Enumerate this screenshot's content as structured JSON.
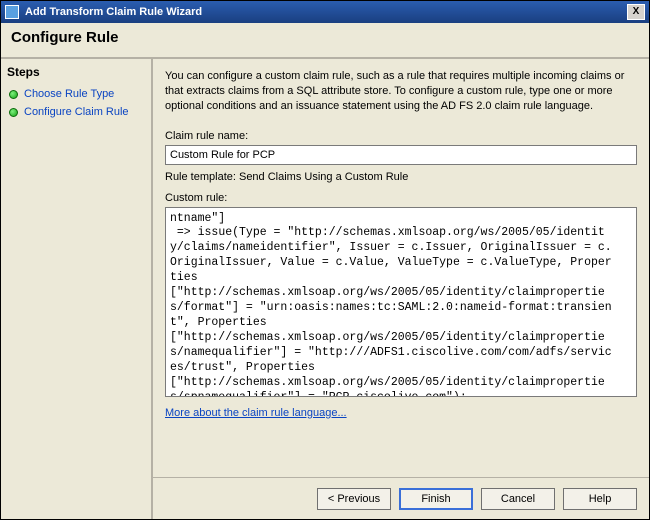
{
  "window": {
    "title": "Add Transform Claim Rule Wizard",
    "close_glyph": "X"
  },
  "header": {
    "title": "Configure Rule"
  },
  "sidebar": {
    "heading": "Steps",
    "items": [
      {
        "label": "Choose Rule Type"
      },
      {
        "label": "Configure Claim Rule"
      }
    ]
  },
  "content": {
    "intro": "You can configure a custom claim rule, such as a rule that requires multiple incoming claims or that extracts claims from a SQL attribute store. To configure a custom rule, type one or more optional conditions and an issuance statement using the AD FS 2.0 claim rule language.",
    "name_label": "Claim rule name:",
    "name_value": "Custom Rule for PCP",
    "template_line": "Rule template: Send Claims Using a Custom Rule",
    "custom_label": "Custom rule:",
    "custom_value": "ntname\"]\n => issue(Type = \"http://schemas.xmlsoap.org/ws/2005/05/identity/claims/nameidentifier\", Issuer = c.Issuer, OriginalIssuer = c.OriginalIssuer, Value = c.Value, ValueType = c.ValueType, Properties\n[\"http://schemas.xmlsoap.org/ws/2005/05/identity/claimproperties/format\"] = \"urn:oasis:names:tc:SAML:2.0:nameid-format:transient\", Properties\n[\"http://schemas.xmlsoap.org/ws/2005/05/identity/claimproperties/namequalifier\"] = \"http:///ADFS1.ciscolive.com/com/adfs/services/trust\", Properties\n[\"http://schemas.xmlsoap.org/ws/2005/05/identity/claimproperties/spnamequalifier\"] = \"PCP.ciscolive.com\");",
    "link_label": "More about the claim rule language..."
  },
  "buttons": {
    "previous": "< Previous",
    "finish": "Finish",
    "cancel": "Cancel",
    "help": "Help"
  }
}
